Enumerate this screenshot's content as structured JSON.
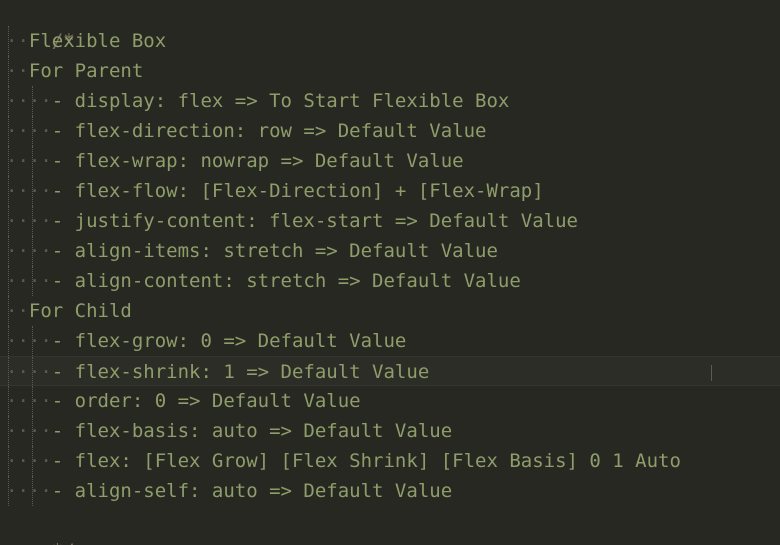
{
  "comment_open": "/*",
  "comment_close": "*/",
  "lines": [
    {
      "indent": 1,
      "text": "Flexible Box"
    },
    {
      "indent": 1,
      "text": "For Parent"
    },
    {
      "indent": 2,
      "text": "- display: flex => To Start Flexible Box"
    },
    {
      "indent": 2,
      "text": "- flex-direction: row => Default Value"
    },
    {
      "indent": 2,
      "text": "- flex-wrap: nowrap => Default Value"
    },
    {
      "indent": 2,
      "text": "- flex-flow: [Flex-Direction] + [Flex-Wrap]"
    },
    {
      "indent": 2,
      "text": "- justify-content: flex-start => Default Value"
    },
    {
      "indent": 2,
      "text": "- align-items: stretch => Default Value"
    },
    {
      "indent": 2,
      "text": "- align-content: stretch => Default Value"
    },
    {
      "indent": 1,
      "text": "For Child"
    },
    {
      "indent": 2,
      "text": "- flex-grow: 0 => Default Value"
    },
    {
      "indent": 2,
      "text": "- flex-shrink: 1 => Default Value",
      "active": true
    },
    {
      "indent": 2,
      "text": "- order: 0 => Default Value"
    },
    {
      "indent": 2,
      "text": "- flex-basis: auto => Default Value"
    },
    {
      "indent": 2,
      "text": "- flex: [Flex Grow] [Flex Shrink] [Flex Basis] 0 1 Auto"
    },
    {
      "indent": 2,
      "text": "- align-self: auto => Default Value"
    }
  ]
}
